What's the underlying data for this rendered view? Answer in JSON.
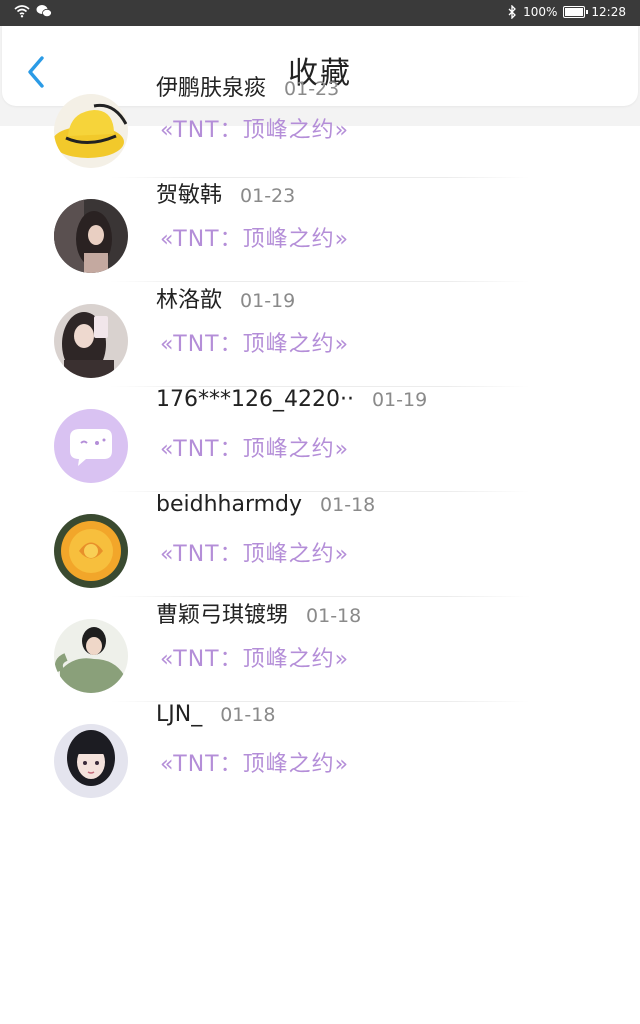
{
  "status_bar": {
    "battery": "100%",
    "time": "12:28"
  },
  "header": {
    "title": "收藏"
  },
  "favorites": [
    {
      "name": "伊鹏肤泉痰",
      "date": "01-23",
      "work": "«TNT：顶峰之约»",
      "avatar": "yellow-hat"
    },
    {
      "name": "贺敏韩",
      "date": "01-23",
      "work": "«TNT：顶峰之约»",
      "avatar": "dark-hair-girl"
    },
    {
      "name": "林洛歆",
      "date": "01-19",
      "work": "«TNT：顶峰之约»",
      "avatar": "girl-phone-selfie"
    },
    {
      "name": "176***126_4220··",
      "date": "01-19",
      "work": "«TNT：顶峰之约»",
      "avatar": "default-purple-chat"
    },
    {
      "name": "beidhharmdy",
      "date": "01-18",
      "work": "«TNT：顶峰之约»",
      "avatar": "yellow-rose"
    },
    {
      "name": "曹颖弓琪镀甥",
      "date": "01-18",
      "work": "«TNT：顶峰之约»",
      "avatar": "girl-green-sweater"
    },
    {
      "name": "LJN_",
      "date": "01-18",
      "work": "«TNT：顶峰之约»",
      "avatar": "anime-girl"
    }
  ],
  "colors": {
    "status_bar_bg": "#3a3a3a",
    "accent_blue": "#2b9be6",
    "work_title_purple": "#b48ed8",
    "default_avatar_purple": "#d9c2f2"
  }
}
